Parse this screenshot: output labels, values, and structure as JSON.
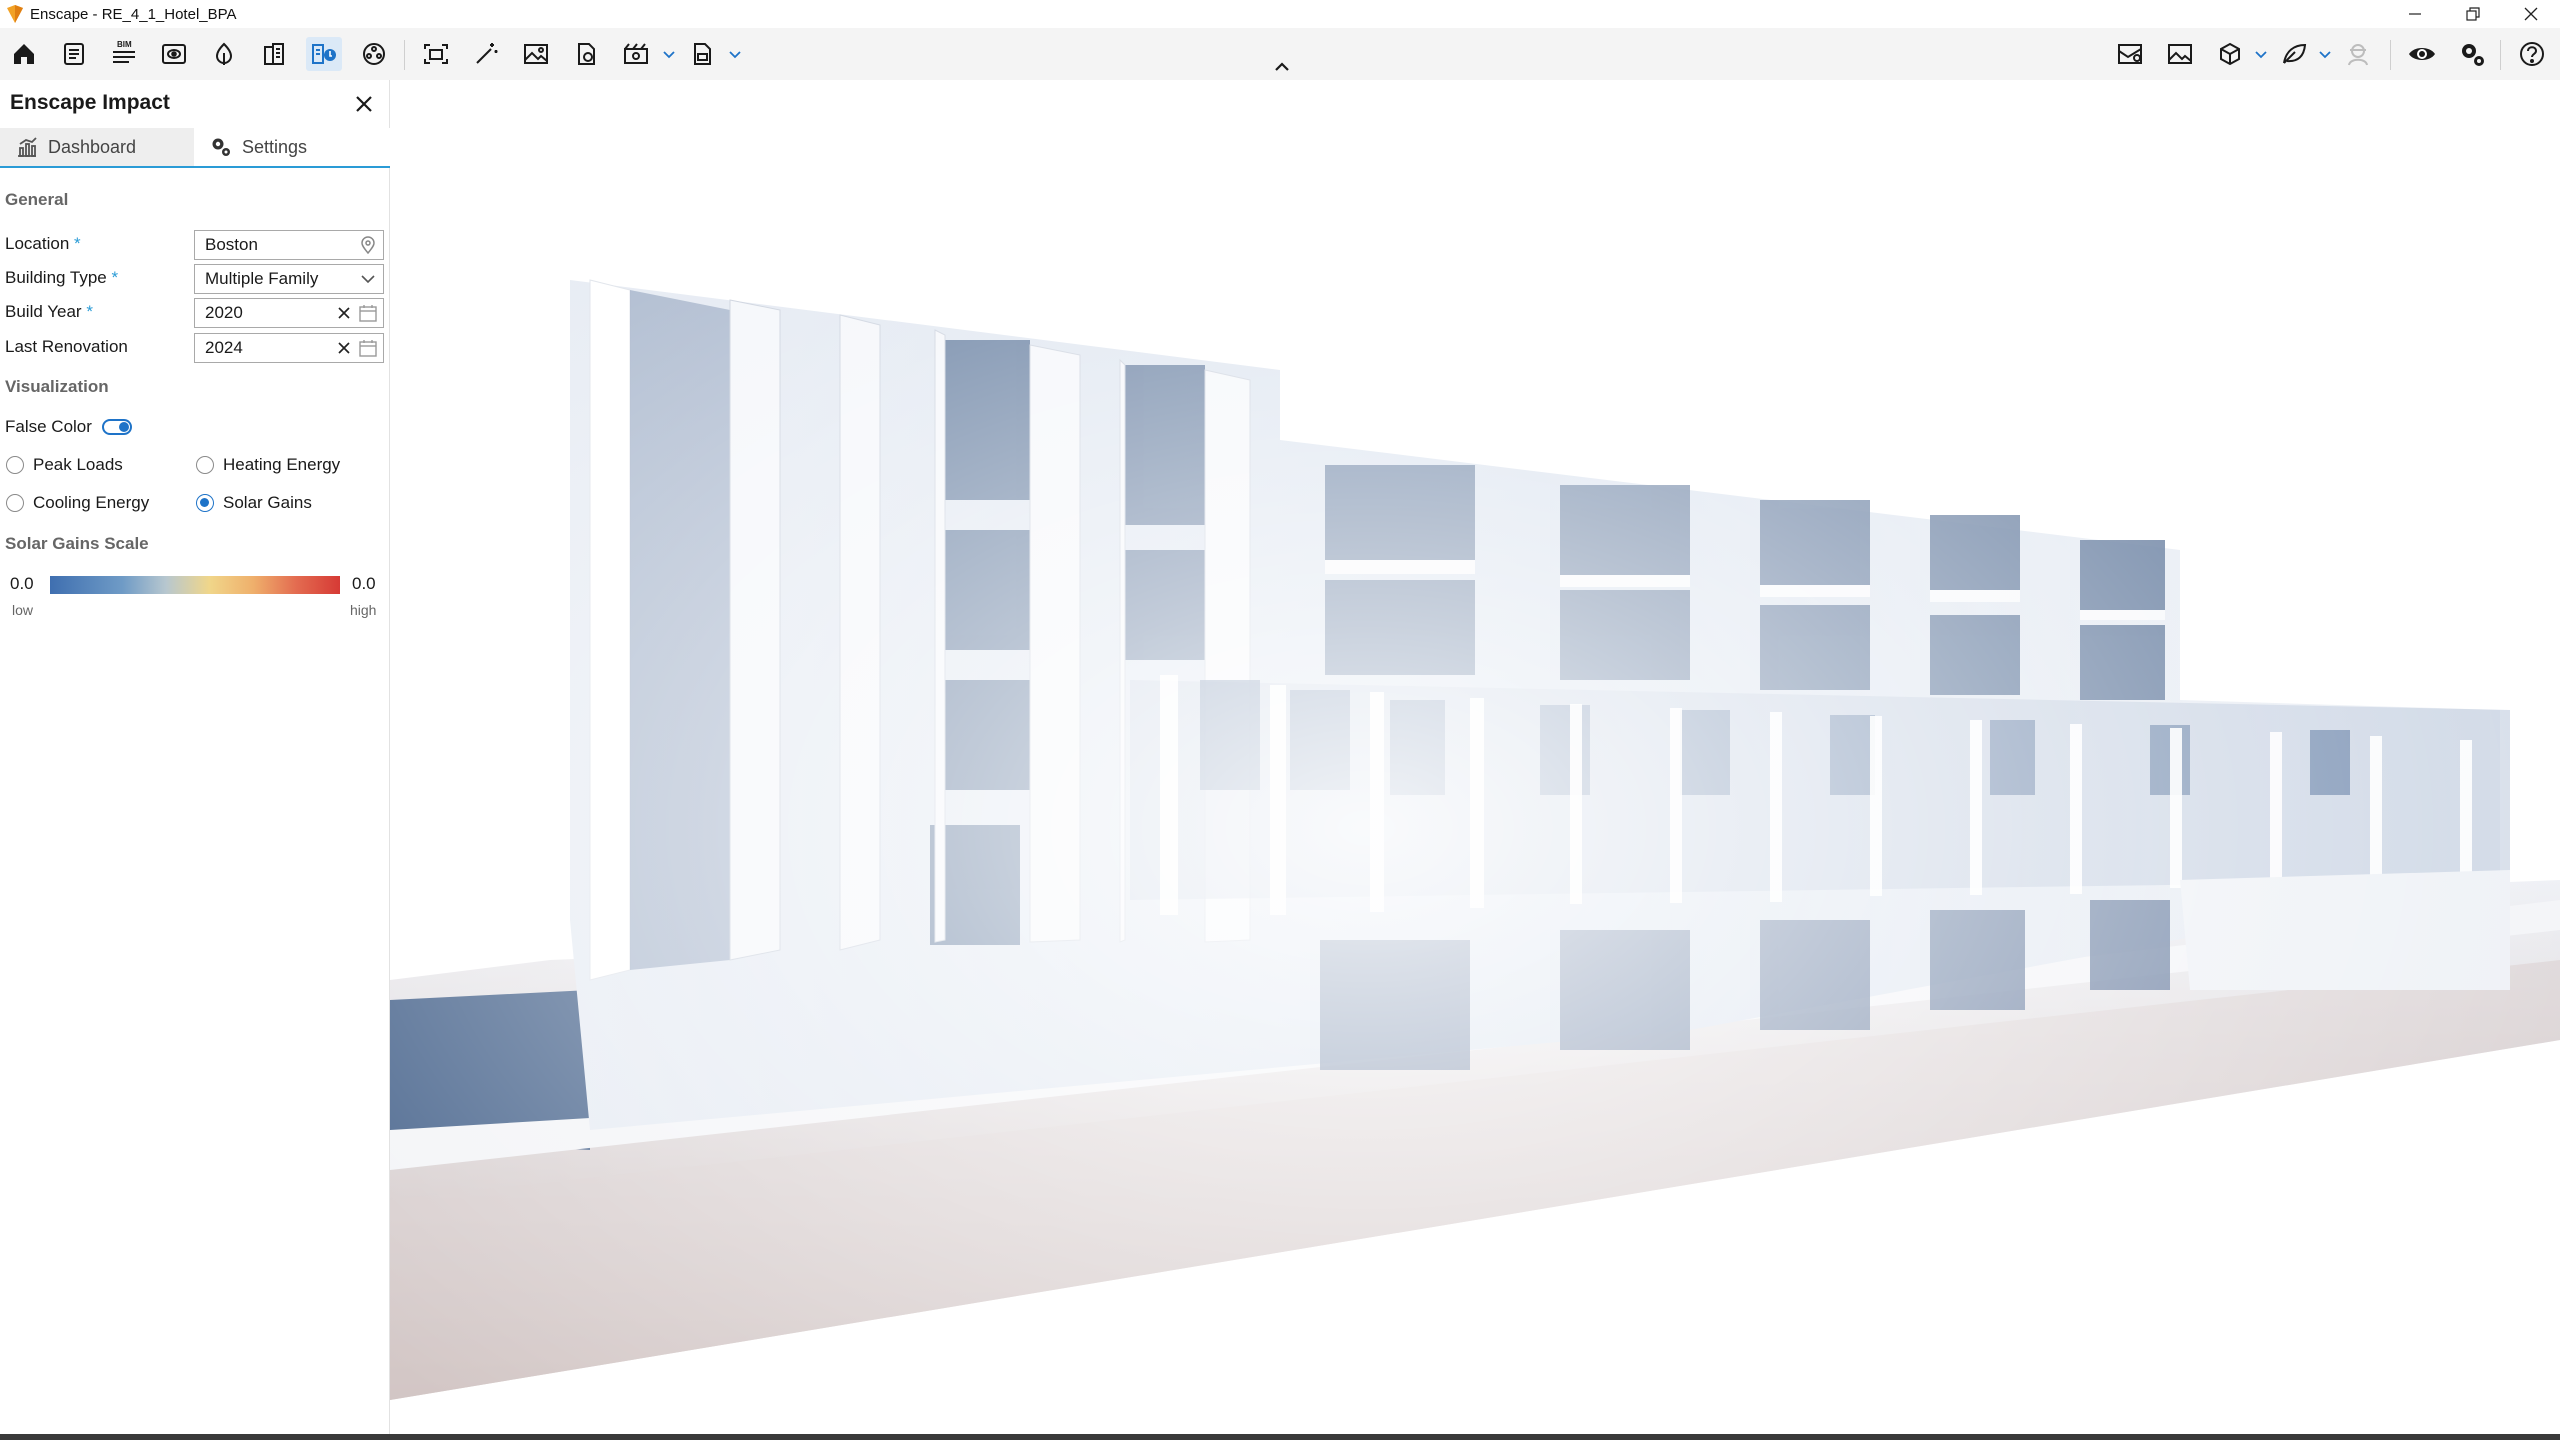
{
  "window": {
    "title": "Enscape - RE_4_1_Hotel_BPA",
    "logo_icon": "enscape-logo-icon",
    "accent_color": "#1e73c8"
  },
  "toolbar": {
    "left_icons": [
      "home-icon",
      "document-icon",
      "bim-icon",
      "view-icon",
      "asset-icon",
      "building-icon",
      "impact-icon",
      "material-icon",
      "screenshot-icon",
      "magic-wand-icon",
      "image-icon",
      "pdf-icon",
      "batch-icon",
      "export-icon"
    ],
    "bim_label": "BIM",
    "right_icons": [
      "map-icon",
      "gallery-icon",
      "cube-icon",
      "leaf-icon",
      "person-icon",
      "eye-icon",
      "settings-icon",
      "help-icon"
    ]
  },
  "panel": {
    "title": "Enscape Impact",
    "tabs": {
      "dashboard": "Dashboard",
      "settings": "Settings"
    },
    "general": {
      "heading": "General",
      "location_label": "Location",
      "location_value": "Boston",
      "building_type_label": "Building Type",
      "building_type_value": "Multiple Family",
      "build_year_label": "Build Year",
      "build_year_value": "2020",
      "last_renovation_label": "Last Renovation",
      "last_renovation_value": "2024",
      "required_mark": "*"
    },
    "visualization": {
      "heading": "Visualization",
      "false_color_label": "False Color",
      "false_color_on": true,
      "options": {
        "peak_loads": "Peak Loads",
        "heating_energy": "Heating Energy",
        "cooling_energy": "Cooling Energy",
        "solar_gains": "Solar Gains"
      },
      "selected": "Solar Gains"
    },
    "scale": {
      "heading": "Solar Gains Scale",
      "min_value": "0.0",
      "max_value": "0.0",
      "low_label": "low",
      "high_label": "high"
    }
  }
}
